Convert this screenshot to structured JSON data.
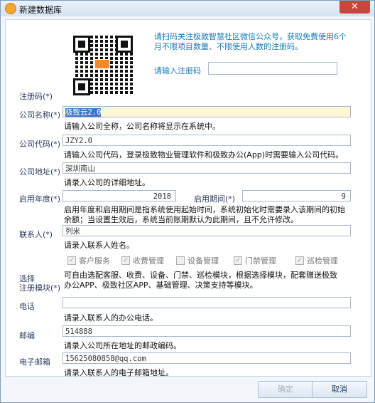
{
  "window": {
    "title": "新建数据库",
    "close_glyph": "✕"
  },
  "registration": {
    "label": "注册码(*)",
    "scan_text": "请扫码关注极致智慧社区微信公众号，获取免费使用6个月不限项目数量、不限使用人数的注册码。",
    "input_label": "请输入注册码",
    "value": ""
  },
  "company_name": {
    "label": "公司名称(*)",
    "value": "极致云2.0",
    "hint": "请输入公司全称，公司名称将显示在系统中。"
  },
  "company_code": {
    "label": "公司代码(*)",
    "value": "JZY2.0",
    "hint": "请输入公司代码，登录极致物业管理软件和极致办公(App)时需要输入公司代码。"
  },
  "company_address": {
    "label": "公司地址(*)",
    "value": "深圳南山",
    "hint": "请录入公司的详细地址。"
  },
  "start_year": {
    "label": "启用年度(*)",
    "year": "2018",
    "period_label": "启用期间(*)",
    "period": "9",
    "hint_1": "启用年度和启用期间是指系统使用起始时间，系统初始化时需要录入该期间的初始",
    "hint_2": "余额；当设置生效后，系统当前账期默认为此期间，且不允许修改。"
  },
  "contact": {
    "label": "联系人(*)",
    "value": "列米",
    "hint": "请录入联系人姓名。"
  },
  "modules": {
    "label_1": "选择",
    "label_2": "注册模块(*)",
    "items": [
      {
        "label": "客户服务",
        "checked": true
      },
      {
        "label": "收费管理",
        "checked": true
      },
      {
        "label": "设备管理",
        "checked": false
      },
      {
        "label": "门禁管理",
        "checked": true
      },
      {
        "label": "巡检管理",
        "checked": true
      }
    ],
    "hint_1": "可自由选配客服、收费、设备、门禁、巡检模块，根据选择模块，配套赠送极致",
    "hint_2": "办公APP、极致社区APP、基础管理、决策支持等模块。"
  },
  "phone": {
    "label": "电话",
    "value": "",
    "hint": "请录入联系人的办公电话。"
  },
  "postcode": {
    "label": "邮编",
    "value": "514888",
    "hint": "请录入公司所在地址的邮政编码。"
  },
  "email": {
    "label": "电子邮箱",
    "value": "15625080858@qq.com",
    "hint": "请录入联系人的电子邮箱地址。"
  },
  "buttons": {
    "confirm": "确定",
    "cancel": "取消"
  },
  "colors": {
    "accent": "#1479b8",
    "label": "#2c3e63"
  }
}
